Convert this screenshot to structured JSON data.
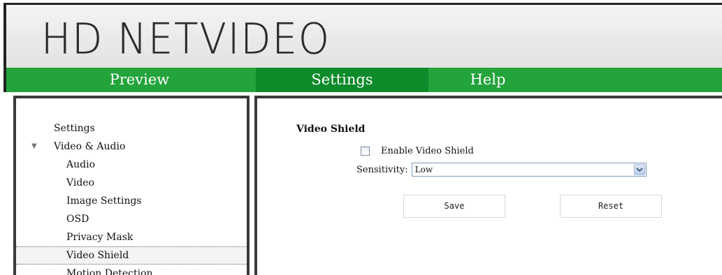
{
  "header": {
    "logo_text": "HD NETVIDEO"
  },
  "nav": {
    "items": [
      {
        "label": "Preview"
      },
      {
        "label": "Settings"
      },
      {
        "label": "Help"
      }
    ],
    "active": "Settings",
    "colors": {
      "bar": "#22a33b",
      "active": "#0d8a2a"
    }
  },
  "sidebar": {
    "items": [
      {
        "label": "Settings"
      },
      {
        "label": "Video & Audio"
      },
      {
        "label": "Audio"
      },
      {
        "label": "Video"
      },
      {
        "label": "Image Settings"
      },
      {
        "label": "OSD"
      },
      {
        "label": "Privacy Mask"
      },
      {
        "label": "Video Shield"
      },
      {
        "label": "Motion Detection"
      }
    ],
    "selected": "Video Shield"
  },
  "main": {
    "section_title": "Video Shield",
    "enable_label": "Enable Video Shield",
    "enable_checked": false,
    "sensitivity_label": "Sensitivity:",
    "sensitivity_value": "Low",
    "save_label": "Save",
    "reset_label": "Reset"
  }
}
